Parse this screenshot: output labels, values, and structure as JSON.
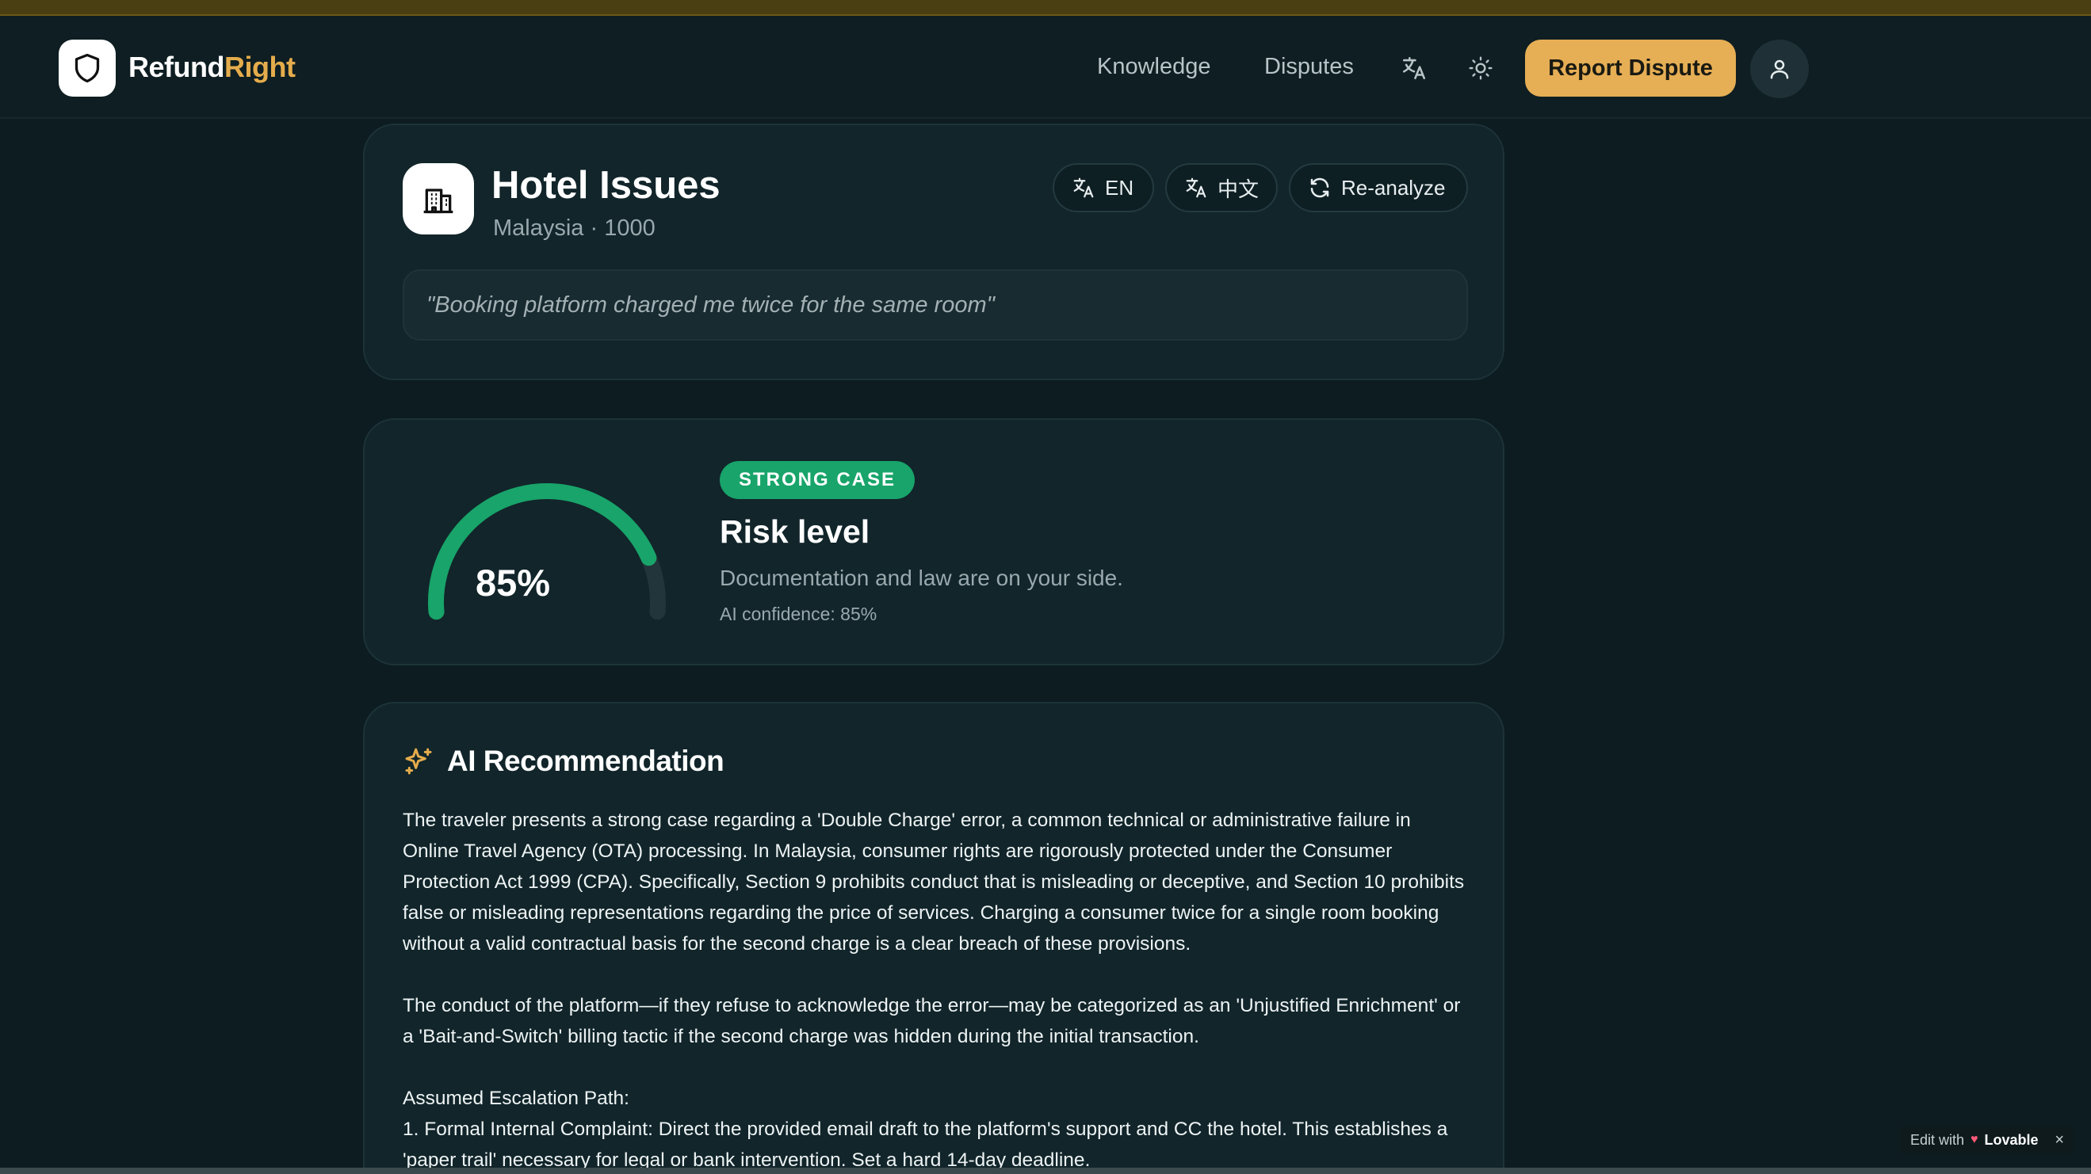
{
  "brand": {
    "part1": "Refund",
    "part2": "Right"
  },
  "nav": {
    "links": [
      "Knowledge",
      "Disputes"
    ],
    "report_label": "Report Dispute",
    "icons": [
      "translate-icon",
      "sun-icon",
      "user-icon"
    ]
  },
  "case": {
    "title": "Hotel Issues",
    "subtitle": "Malaysia · 1000",
    "quote": "\"Booking platform charged me twice for the same room\"",
    "buttons": {
      "en": "EN",
      "zh": "中文",
      "reanalyze": "Re-analyze"
    }
  },
  "risk": {
    "badge": "STRONG CASE",
    "title": "Risk level",
    "description": "Documentation and law are on your side.",
    "confidence": "AI confidence: 85%",
    "gauge_label": "85%",
    "gauge_fraction": 0.85,
    "color": "#18a46a"
  },
  "recommendation": {
    "title": "AI Recommendation",
    "paragraphs": [
      "The traveler presents a strong case regarding a 'Double Charge' error, a common technical or administrative failure in Online Travel Agency (OTA) processing. In Malaysia, consumer rights are rigorously protected under the Consumer Protection Act 1999 (CPA). Specifically, Section 9 prohibits conduct that is misleading or deceptive, and Section 10 prohibits false or misleading representations regarding the price of services. Charging a consumer twice for a single room booking without a valid contractual basis for the second charge is a clear breach of these provisions.",
      "The conduct of the platform—if they refuse to acknowledge the error—may be categorized as an 'Unjustified Enrichment' or a 'Bait-and-Switch' billing tactic if the second charge was hidden during the initial transaction.",
      "Assumed Escalation Path:",
      "1. Formal Internal Complaint: Direct the provided email draft to the platform's support and CC the hotel. This establishes a 'paper trail' necessary for legal or bank intervention. Set a hard 14-day deadline."
    ]
  },
  "lovable": {
    "prefix": "Edit with",
    "name": "Lovable",
    "close": "×"
  },
  "colors": {
    "accent": "#e6ae55",
    "success": "#18a46a",
    "background": "#0c1c20",
    "card": "#11252a"
  }
}
